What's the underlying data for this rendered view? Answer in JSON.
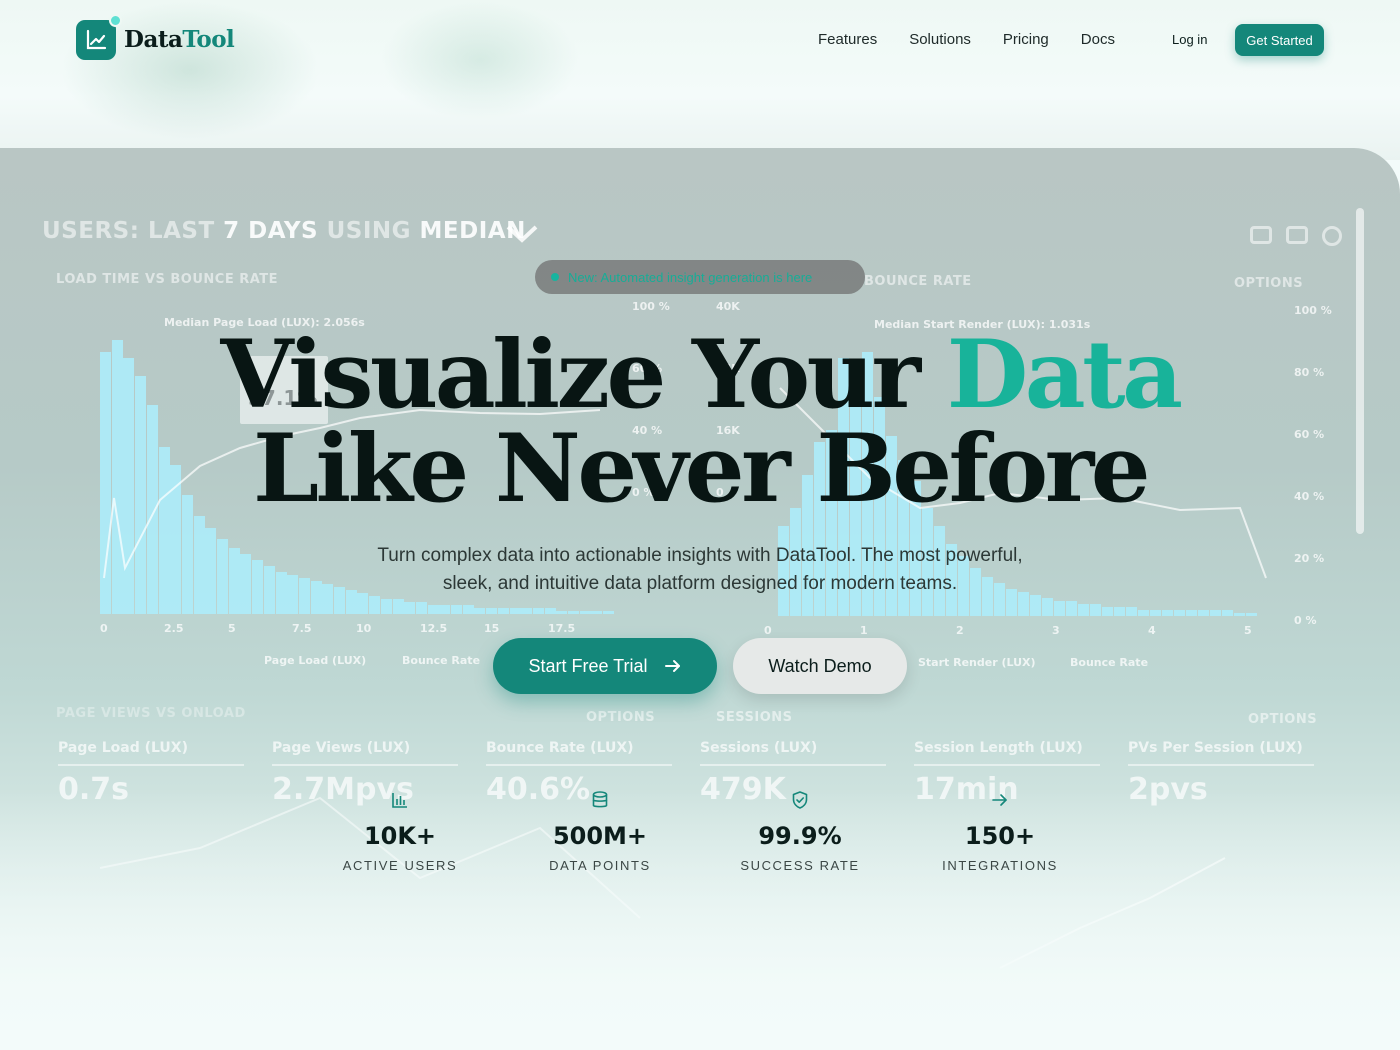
{
  "brand": {
    "name_part1": "Data",
    "name_part2": "Tool"
  },
  "nav": {
    "items": [
      "Features",
      "Solutions",
      "Pricing",
      "Docs"
    ]
  },
  "auth": {
    "login_label": "Log in",
    "cta_label": "Get Started"
  },
  "badge": {
    "text": "New: Automated insight generation is here"
  },
  "hero": {
    "title_line1_part1": "Visualize Your ",
    "title_line1_accent": "Data",
    "title_line2": "Like Never Before",
    "subtitle": "Turn complex data into actionable insights with DataTool. The most powerful, sleek, and intuitive data platform designed for modern teams."
  },
  "actions": {
    "primary_label": "Start Free Trial",
    "secondary_label": "Watch Demo"
  },
  "stats": [
    {
      "icon": "bar-chart-icon",
      "value": "10K+",
      "label": "ACTIVE USERS"
    },
    {
      "icon": "database-icon",
      "value": "500M+",
      "label": "DATA POINTS"
    },
    {
      "icon": "shield-check-icon",
      "value": "99.9%",
      "label": "SUCCESS RATE"
    },
    {
      "icon": "arrow-right-icon",
      "value": "150+",
      "label": "INTEGRATIONS"
    }
  ],
  "background_dashboard": {
    "title_dim1": "USERS: ",
    "title_dim2": "LAST ",
    "title_strong1": "7 DAYS ",
    "title_dim3": "USING ",
    "title_strong2": "MEDIAN",
    "panel_left_title": "LOAD TIME VS BOUNCE RATE",
    "panel_right_title": "BOUNCE RATE",
    "panel_left_annotation": "Median Page Load (LUX): 2.056s",
    "panel_right_annotation": "Median Start Render (LUX): 1.031s",
    "tooltip_value": "57.1%",
    "options_label": "OPTIONS",
    "left_x_ticks": [
      "0",
      "2.5",
      "5",
      "7.5",
      "10",
      "12.5",
      "15",
      "17.5"
    ],
    "right_x_ticks": [
      "0",
      "1",
      "2",
      "3",
      "4",
      "5"
    ],
    "mid_pct_ticks": [
      "100 %",
      "60 %",
      "40 %",
      "0 %"
    ],
    "mid_count_ticks": [
      "40K",
      "24K",
      "16K",
      "0"
    ],
    "right_pct_ticks": [
      "100 %",
      "80 %",
      "60 %",
      "40 %",
      "20 %",
      "0 %"
    ],
    "legend_left": [
      "Page Load (LUX)",
      "Bounce Rate"
    ],
    "legend_right": [
      "Start Render (LUX)",
      "Bounce Rate"
    ],
    "lower_left_title": "PAGE VIEWS VS ONLOAD",
    "lower_mid_title": "SESSIONS",
    "metrics": [
      {
        "label": "Page Load (LUX)",
        "value": "0.7s"
      },
      {
        "label": "Page Views (LUX)",
        "value": "2.7Mpvs"
      },
      {
        "label": "Bounce Rate (LUX)",
        "value": "40.6%"
      },
      {
        "label": "Sessions (LUX)",
        "value": "479K"
      },
      {
        "label": "Session Length (LUX)",
        "value": "17min"
      },
      {
        "label": "PVs Per Session (LUX)",
        "value": "2pvs"
      }
    ],
    "left_bars": [
      88,
      92,
      86,
      80,
      70,
      56,
      50,
      40,
      33,
      29,
      25,
      22,
      20,
      18,
      16,
      14,
      13,
      12,
      11,
      10,
      9,
      8,
      7,
      6,
      5,
      5,
      4,
      4,
      3,
      3,
      3,
      3,
      2,
      2,
      2,
      2,
      2,
      2,
      2,
      1,
      1,
      1,
      1,
      1
    ],
    "right_bars": [
      30,
      36,
      47,
      58,
      62,
      86,
      84,
      88,
      73,
      60,
      52,
      45,
      36,
      30,
      24,
      20,
      16,
      13,
      11,
      9,
      8,
      7,
      6,
      5,
      5,
      4,
      4,
      3,
      3,
      3,
      2,
      2,
      2,
      2,
      2,
      2,
      2,
      2,
      1,
      1
    ]
  }
}
